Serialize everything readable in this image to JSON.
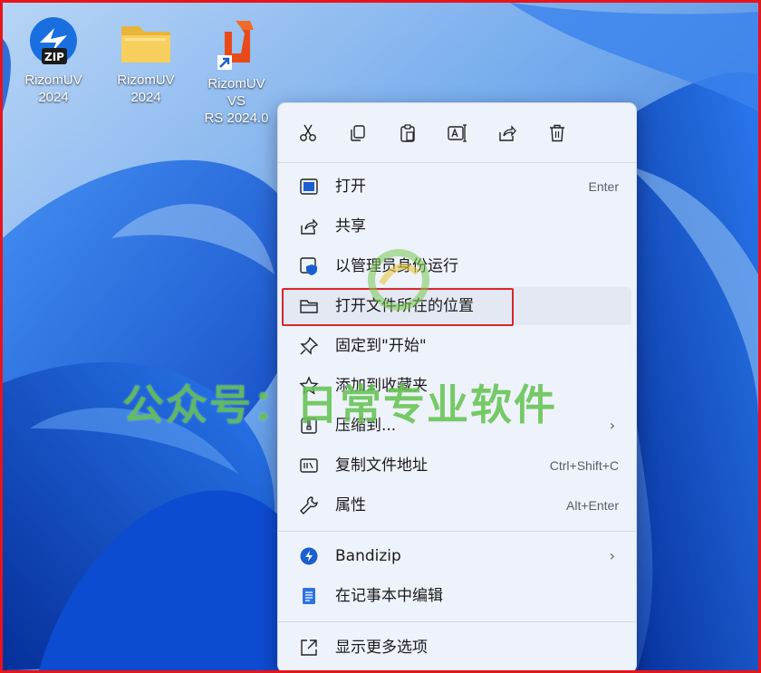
{
  "desktop": {
    "icons": [
      {
        "label": "RizomUV\n2024",
        "icon": "zip-archive-icon"
      },
      {
        "label": "RizomUV\n2024",
        "icon": "folder-icon"
      },
      {
        "label": "RizomUV VS\nRS 2024.0",
        "icon": "rizomuv-app-icon"
      }
    ]
  },
  "context_menu": {
    "toolbar": [
      {
        "name": "cut",
        "icon": "scissors-icon"
      },
      {
        "name": "copy",
        "icon": "copy-icon"
      },
      {
        "name": "paste",
        "icon": "paste-icon"
      },
      {
        "name": "rename",
        "icon": "rename-icon"
      },
      {
        "name": "share",
        "icon": "share-icon"
      },
      {
        "name": "delete",
        "icon": "trash-icon"
      }
    ],
    "items": [
      {
        "label": "打开",
        "shortcut": "Enter",
        "icon": "open-icon"
      },
      {
        "label": "共享",
        "shortcut": "",
        "icon": "share-icon"
      },
      {
        "label": "以管理员身份运行",
        "shortcut": "",
        "icon": "admin-shield-icon"
      },
      {
        "label": "打开文件所在的位置",
        "shortcut": "",
        "icon": "folder-outline-icon",
        "highlighted": true
      },
      {
        "label": "固定到\"开始\"",
        "shortcut": "",
        "icon": "pin-icon"
      },
      {
        "label": "添加到收藏夹",
        "shortcut": "",
        "icon": "star-icon"
      },
      {
        "label": "压缩到...",
        "shortcut": "",
        "icon": "compress-icon",
        "submenu": true
      },
      {
        "label": "复制文件地址",
        "shortcut": "Ctrl+Shift+C",
        "icon": "copy-path-icon"
      },
      {
        "label": "属性",
        "shortcut": "Alt+Enter",
        "icon": "wrench-icon"
      },
      {
        "label": "Bandizip",
        "shortcut": "",
        "icon": "bandizip-icon",
        "submenu": true
      },
      {
        "label": "在记事本中编辑",
        "shortcut": "",
        "icon": "notepad-icon"
      },
      {
        "label": "显示更多选项",
        "shortcut": "",
        "icon": "more-options-icon"
      }
    ],
    "submenu_arrow": "›"
  },
  "watermark": {
    "text": "公众号：日常专业软件"
  },
  "colors": {
    "highlight_border": "#d4272d",
    "menu_bg": "#eef2fb",
    "accent": "#0c5fd8"
  }
}
